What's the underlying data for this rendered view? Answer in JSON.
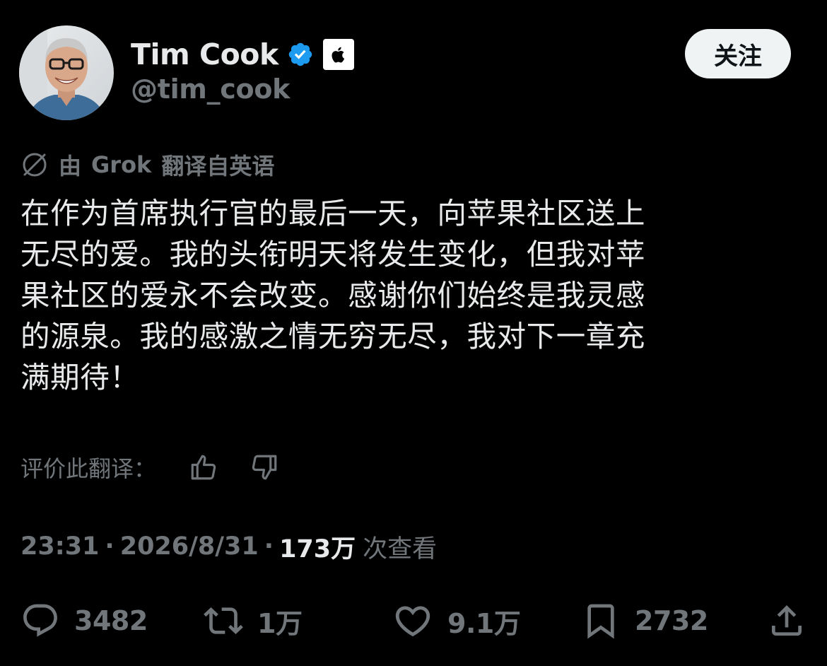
{
  "author": {
    "display_name": "Tim Cook",
    "handle": "@tim_cook",
    "verified_badge_icon": "verified-badge-icon",
    "affiliation_icon": "apple-logo-icon",
    "follow_label": "关注"
  },
  "translation": {
    "note_prefix": "由",
    "note_brand": "Grok",
    "note_suffix": "翻译自英语",
    "icon": "translate-slash-icon"
  },
  "tweet": {
    "text": "在作为首席执行官的最后一天，向苹果社区送上\n无尽的爱。我的头衔明天将发生变化，但我对苹\n果社区的爱永不会改变。感谢你们始终是我灵感\n的源泉。我的感激之情无穷无尽，我对下一章充\n满期待！"
  },
  "rate_translation": {
    "label": "评价此翻译：",
    "thumbs_up_icon": "thumbs-up-icon",
    "thumbs_down_icon": "thumbs-down-icon"
  },
  "meta": {
    "time": "23:31",
    "separator": "·",
    "date": "2026/8/31",
    "views_count": "173万",
    "views_label": "次查看"
  },
  "actions": {
    "reply_count": "3482",
    "repost_count": "1万",
    "like_count": "9.1万",
    "bookmark_count": "2732"
  },
  "colors": {
    "background": "#000000",
    "primary_text": "#e7e9ea",
    "secondary_text": "#71767b",
    "verified_blue": "#1d9bf0",
    "follow_button_bg": "#eff3f4"
  }
}
